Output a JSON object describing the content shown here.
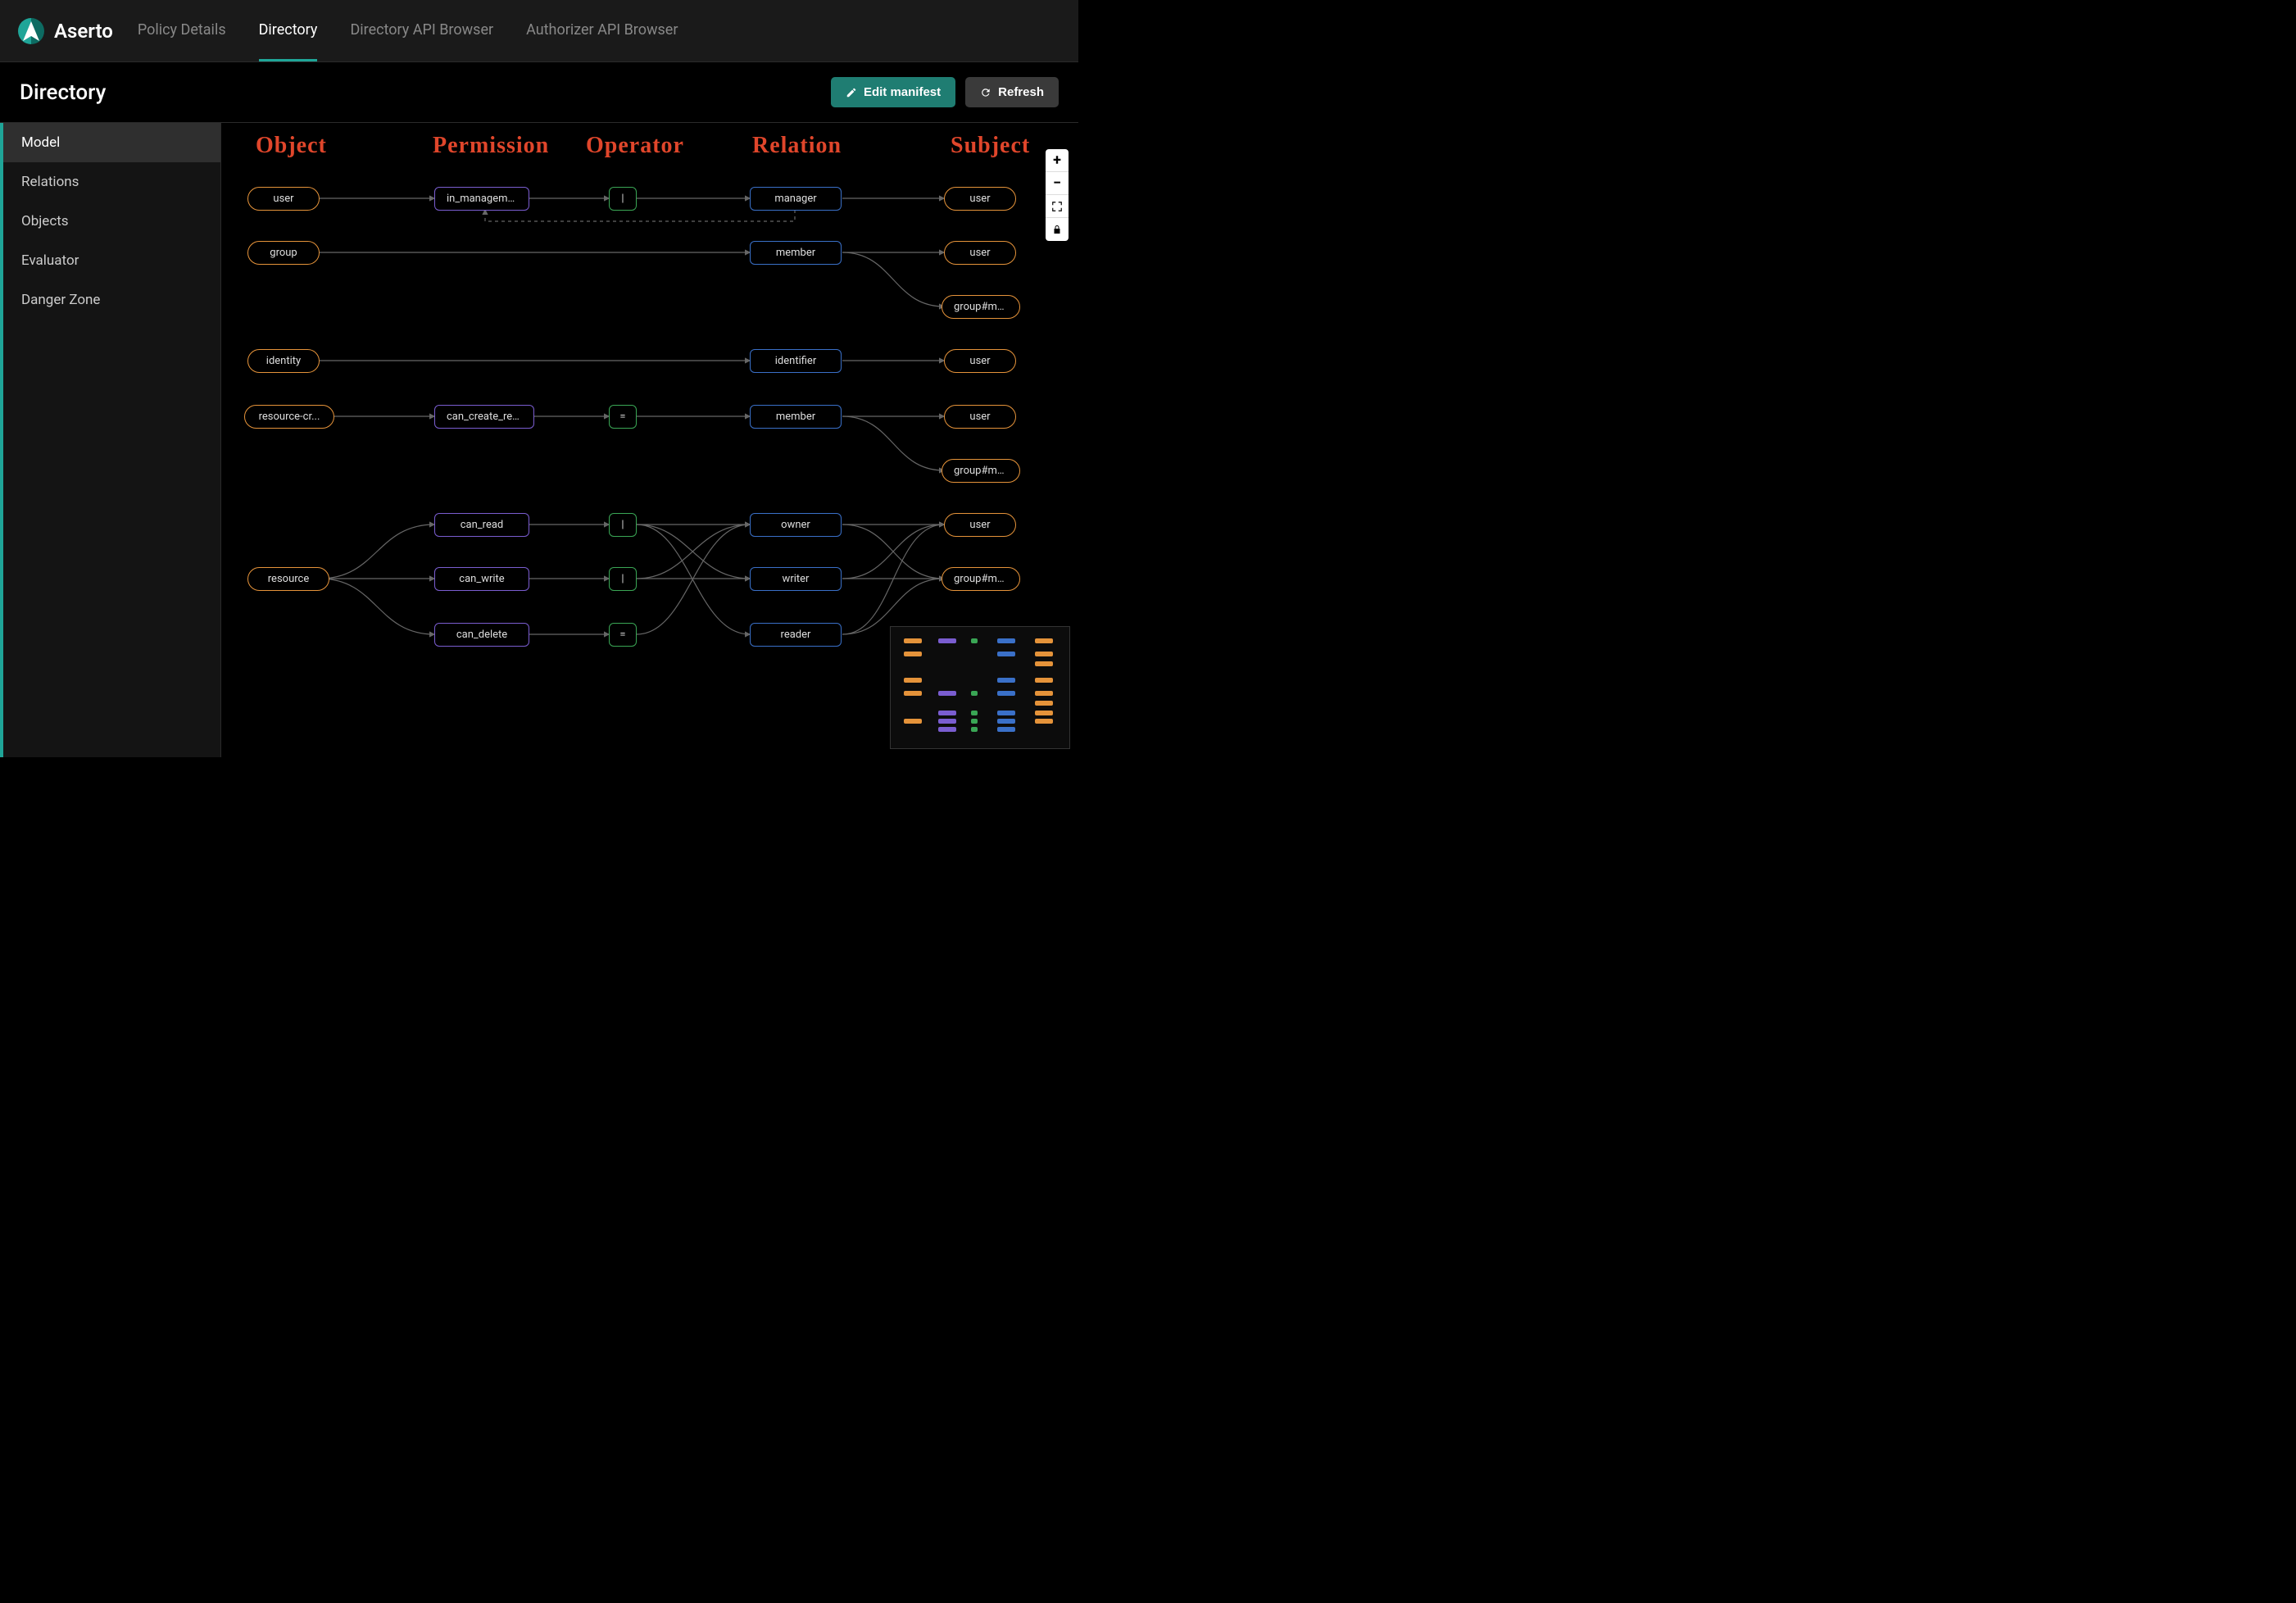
{
  "brand": "Aserto",
  "top_tabs": [
    "Policy Details",
    "Directory",
    "Directory API Browser",
    "Authorizer API Browser"
  ],
  "top_active": 1,
  "page_title": "Directory",
  "buttons": {
    "edit": "Edit manifest",
    "refresh": "Refresh"
  },
  "sidebar": [
    "Model",
    "Relations",
    "Objects",
    "Evaluator",
    "Danger Zone"
  ],
  "sidebar_active": 0,
  "annotations": {
    "col_object": "Object",
    "col_permission": "Permission",
    "col_operator": "Operator",
    "col_relation": "Relation",
    "col_subject": "Subject"
  },
  "nodes": {
    "obj_user": "user",
    "obj_group": "group",
    "obj_identity": "identity",
    "obj_rescr": "resource-cr...",
    "obj_resource": "resource",
    "perm_inmgmt": "in_managemen...",
    "perm_cancreate": "can_create_res...",
    "perm_canread": "can_read",
    "perm_canwrite": "can_write",
    "perm_candelete": "can_delete",
    "op_pipe": "|",
    "op_eq": "=",
    "rel_manager": "manager",
    "rel_member": "member",
    "rel_identifier": "identifier",
    "rel_owner": "owner",
    "rel_writer": "writer",
    "rel_reader": "reader",
    "subj_user": "user",
    "subj_groupmem": "group#mem..."
  }
}
